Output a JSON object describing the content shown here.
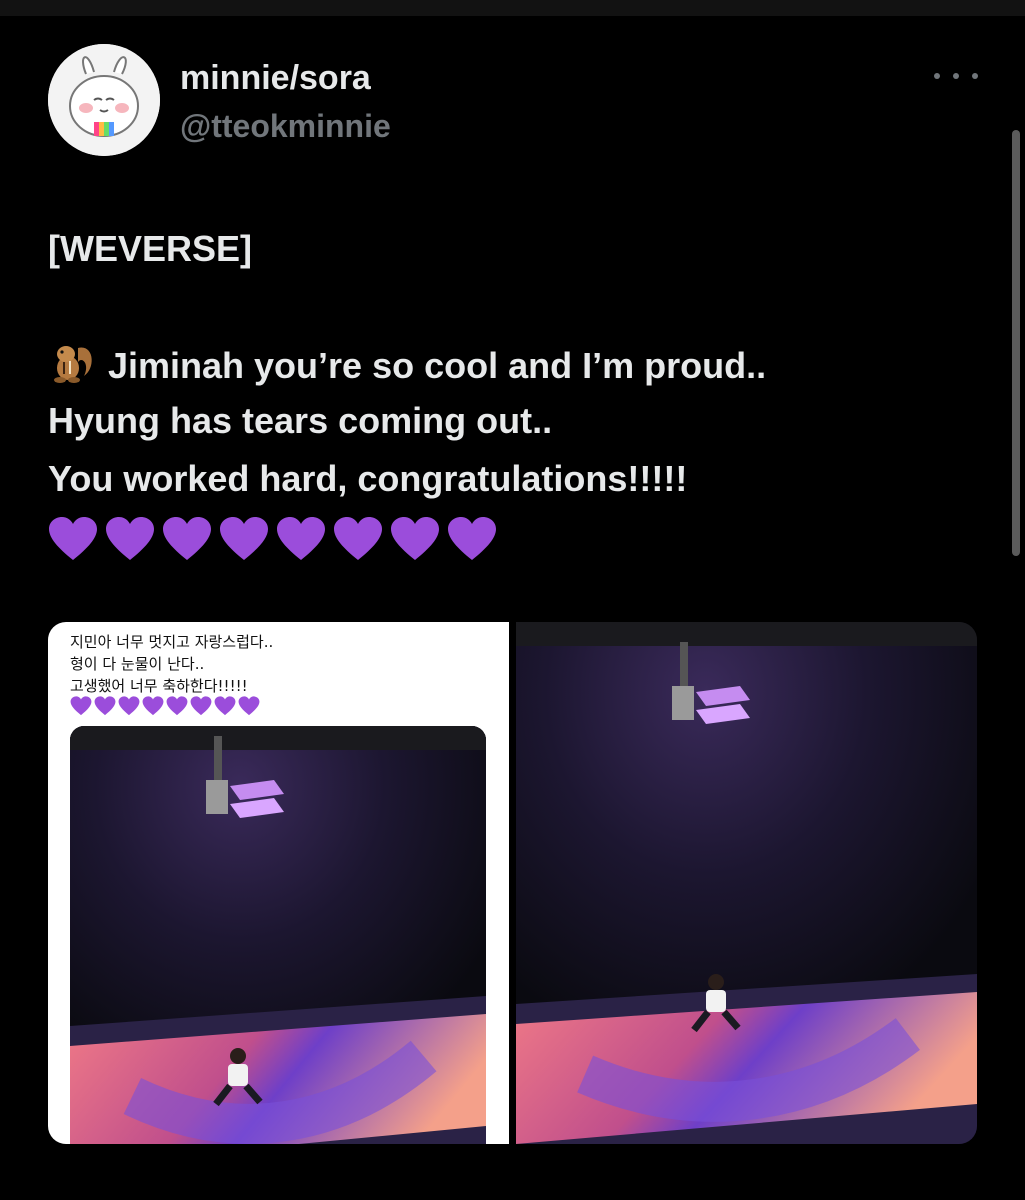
{
  "tweet": {
    "display_name": "minnie/sora",
    "handle": "@tteokminnie",
    "lines": [
      "[WEVERSE]",
      "Jiminah you’re so cool and I’m proud..",
      "Hyung has tears coming out..",
      "You worked hard, congratulations!!!!!"
    ],
    "emoji_lead": "chipmunk-icon",
    "heart_count": 8,
    "heart_color": "#9b4ddb"
  },
  "screenshot_text": [
    "지민아 너무 멋지고 자랑스럽다..",
    "형이 다 눈물이 난다..",
    "고생했어 너무 축하한다!!!!!"
  ],
  "colors": {
    "background": "#000000",
    "text_primary": "#e7e9ea",
    "text_secondary": "#71767b",
    "stage_purple": "#6e3fc8",
    "stage_pink": "#f07a86"
  }
}
